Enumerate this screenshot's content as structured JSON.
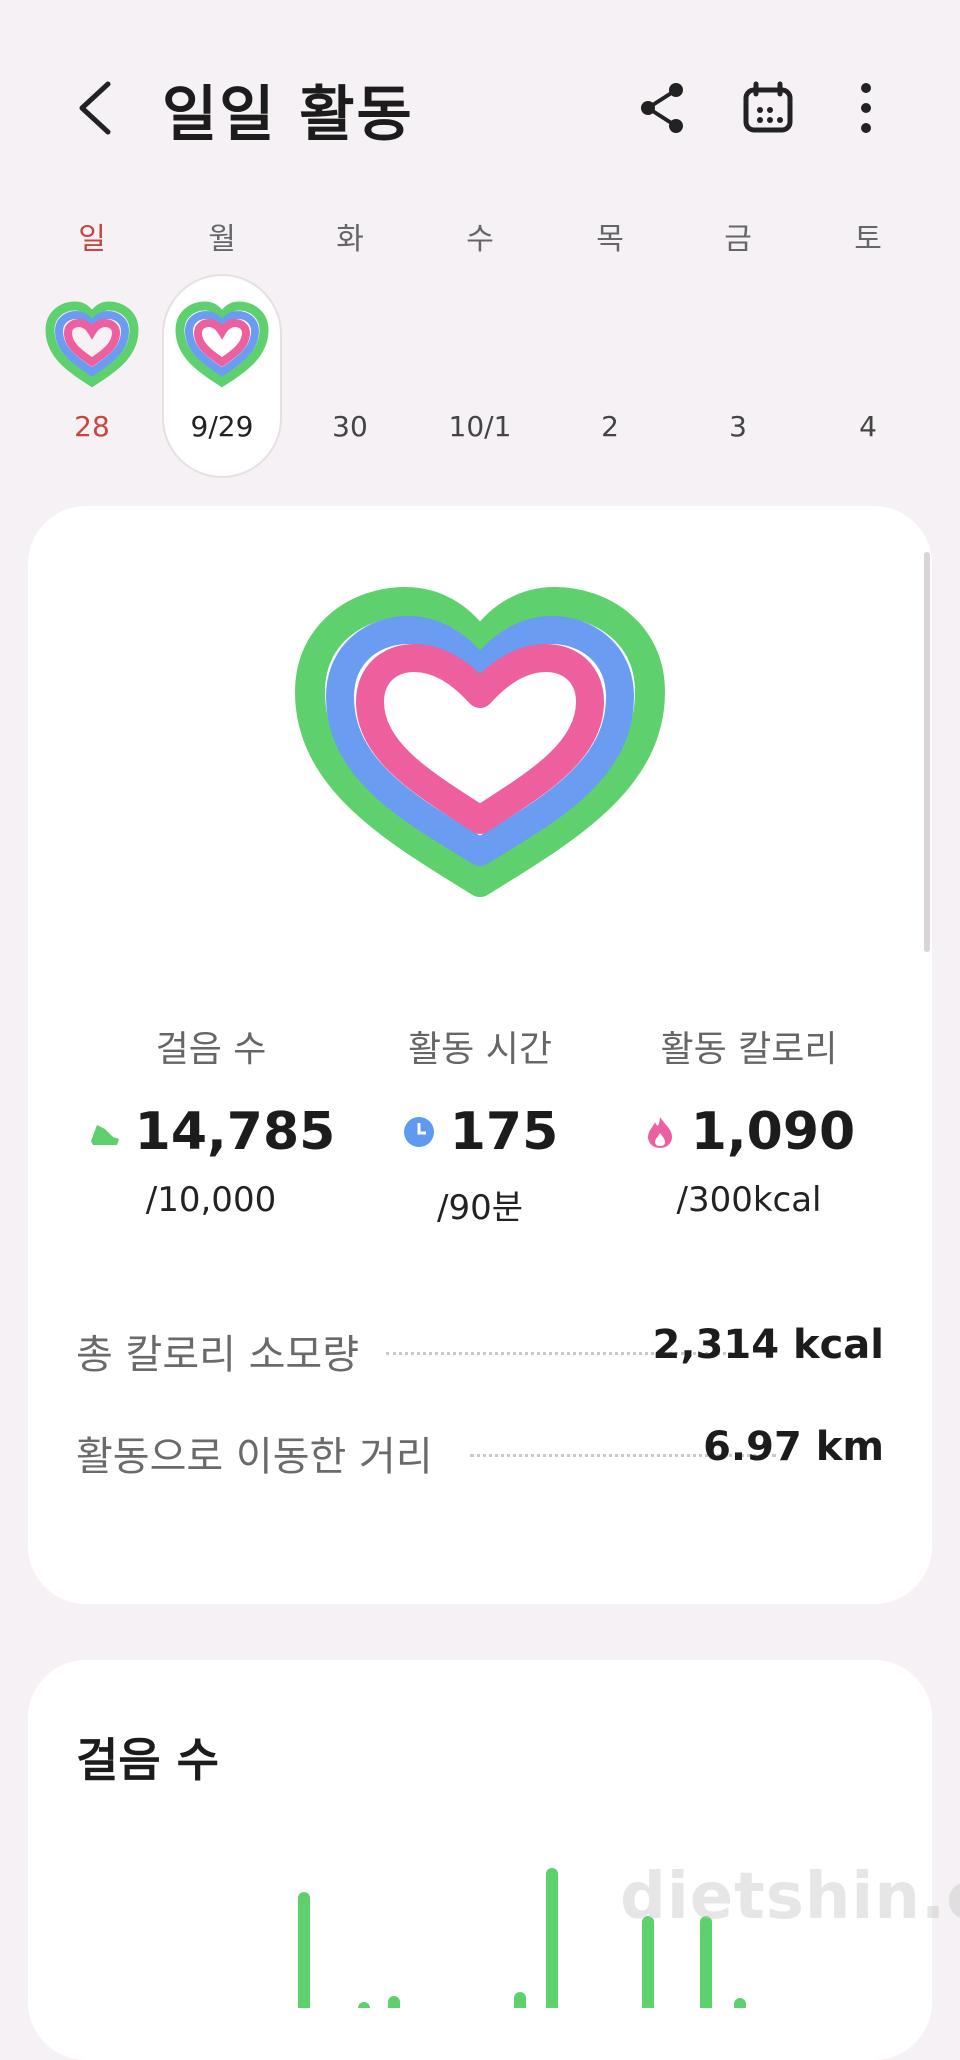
{
  "header": {
    "title": "일일 활동",
    "back_icon": "chevron-left-icon",
    "share_icon": "share-icon",
    "calendar_icon": "calendar-icon",
    "more_icon": "more-vertical-icon"
  },
  "week": [
    {
      "name": "일",
      "date": "28",
      "has_ring": true,
      "selected": false,
      "sunday": true
    },
    {
      "name": "월",
      "date": "9/29",
      "has_ring": true,
      "selected": true,
      "sunday": false
    },
    {
      "name": "화",
      "date": "30",
      "has_ring": false,
      "selected": false,
      "sunday": false
    },
    {
      "name": "수",
      "date": "10/1",
      "has_ring": false,
      "selected": false,
      "sunday": false
    },
    {
      "name": "목",
      "date": "2",
      "has_ring": false,
      "selected": false,
      "sunday": false
    },
    {
      "name": "금",
      "date": "3",
      "has_ring": false,
      "selected": false,
      "sunday": false
    },
    {
      "name": "토",
      "date": "4",
      "has_ring": false,
      "selected": false,
      "sunday": false
    }
  ],
  "stats": [
    {
      "label": "걸음 수",
      "value": "14,785",
      "goal": "/10,000",
      "icon": "shoe-icon",
      "color": "#5fd06e"
    },
    {
      "label": "활동 시간",
      "value": "175",
      "goal": "/90분",
      "icon": "clock-icon",
      "color": "#5e9bf0"
    },
    {
      "label": "활동 칼로리",
      "value": "1,090",
      "goal": "/300kcal",
      "icon": "flame-icon",
      "color": "#ec5fa0"
    }
  ],
  "details": [
    {
      "label": "총 칼로리 소모량",
      "value": "2,314 kcal"
    },
    {
      "label": "활동으로 이동한 거리",
      "value": "6.97 km"
    }
  ],
  "steps_section": {
    "title": "걸음 수",
    "watermark": "dietshin.com"
  },
  "colors": {
    "ring_green": "#5fd06e",
    "ring_blue": "#6a9cf2",
    "ring_pink": "#ee5f9e",
    "sunday": "#c8463f"
  }
}
